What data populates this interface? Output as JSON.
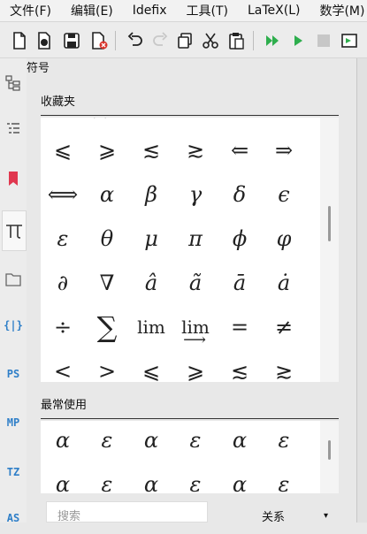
{
  "menu": [
    "文件(F)",
    "编辑(E)",
    "Idefix",
    "工具(T)",
    "LaTeX(L)",
    "数学(M)"
  ],
  "toolbar": {
    "icons": [
      "new-file-icon",
      "new-from-template-icon",
      "save-icon",
      "close-file-icon",
      "undo-icon",
      "redo-icon",
      "copy-icon",
      "cut-icon",
      "paste-icon",
      "build-and-view-icon",
      "compile-icon",
      "stop-icon",
      "view-icon"
    ]
  },
  "sidebar": {
    "items": [
      "structure-icon",
      "todo-list-icon",
      "bookmark-icon",
      "symbols-pi-icon",
      "files-icon",
      "braces-icon",
      "PS",
      "MP",
      "TZ",
      "AS"
    ]
  },
  "panel": {
    "title": "符号",
    "favorites_header": "收藏夹",
    "most_used_header": "最常使用",
    "search_placeholder": "搜索",
    "category_label": "关系",
    "category_arrow": "▾"
  },
  "favorites_rows": [
    [
      "⩽",
      "⩾",
      "≲",
      "≳",
      "⇐",
      "⇒"
    ],
    [
      "⟺",
      "α",
      "β",
      "γ",
      "δ",
      "ϵ"
    ],
    [
      "ε",
      "θ",
      "μ",
      "π",
      "ϕ",
      "φ"
    ],
    [
      "∂",
      "∇",
      "â",
      "ã",
      "ā",
      "ȧ"
    ],
    [
      "÷",
      "∑",
      "lim",
      "lim",
      "=",
      "≠"
    ],
    [
      "<",
      ">",
      "⩽",
      "⩾",
      "≲",
      "≳"
    ]
  ],
  "most_used_rows": [
    [
      "α",
      "ε",
      "α",
      "ε",
      "α",
      "ε"
    ],
    [
      "α",
      "ε",
      "α",
      "ε",
      "α",
      "ε"
    ]
  ]
}
